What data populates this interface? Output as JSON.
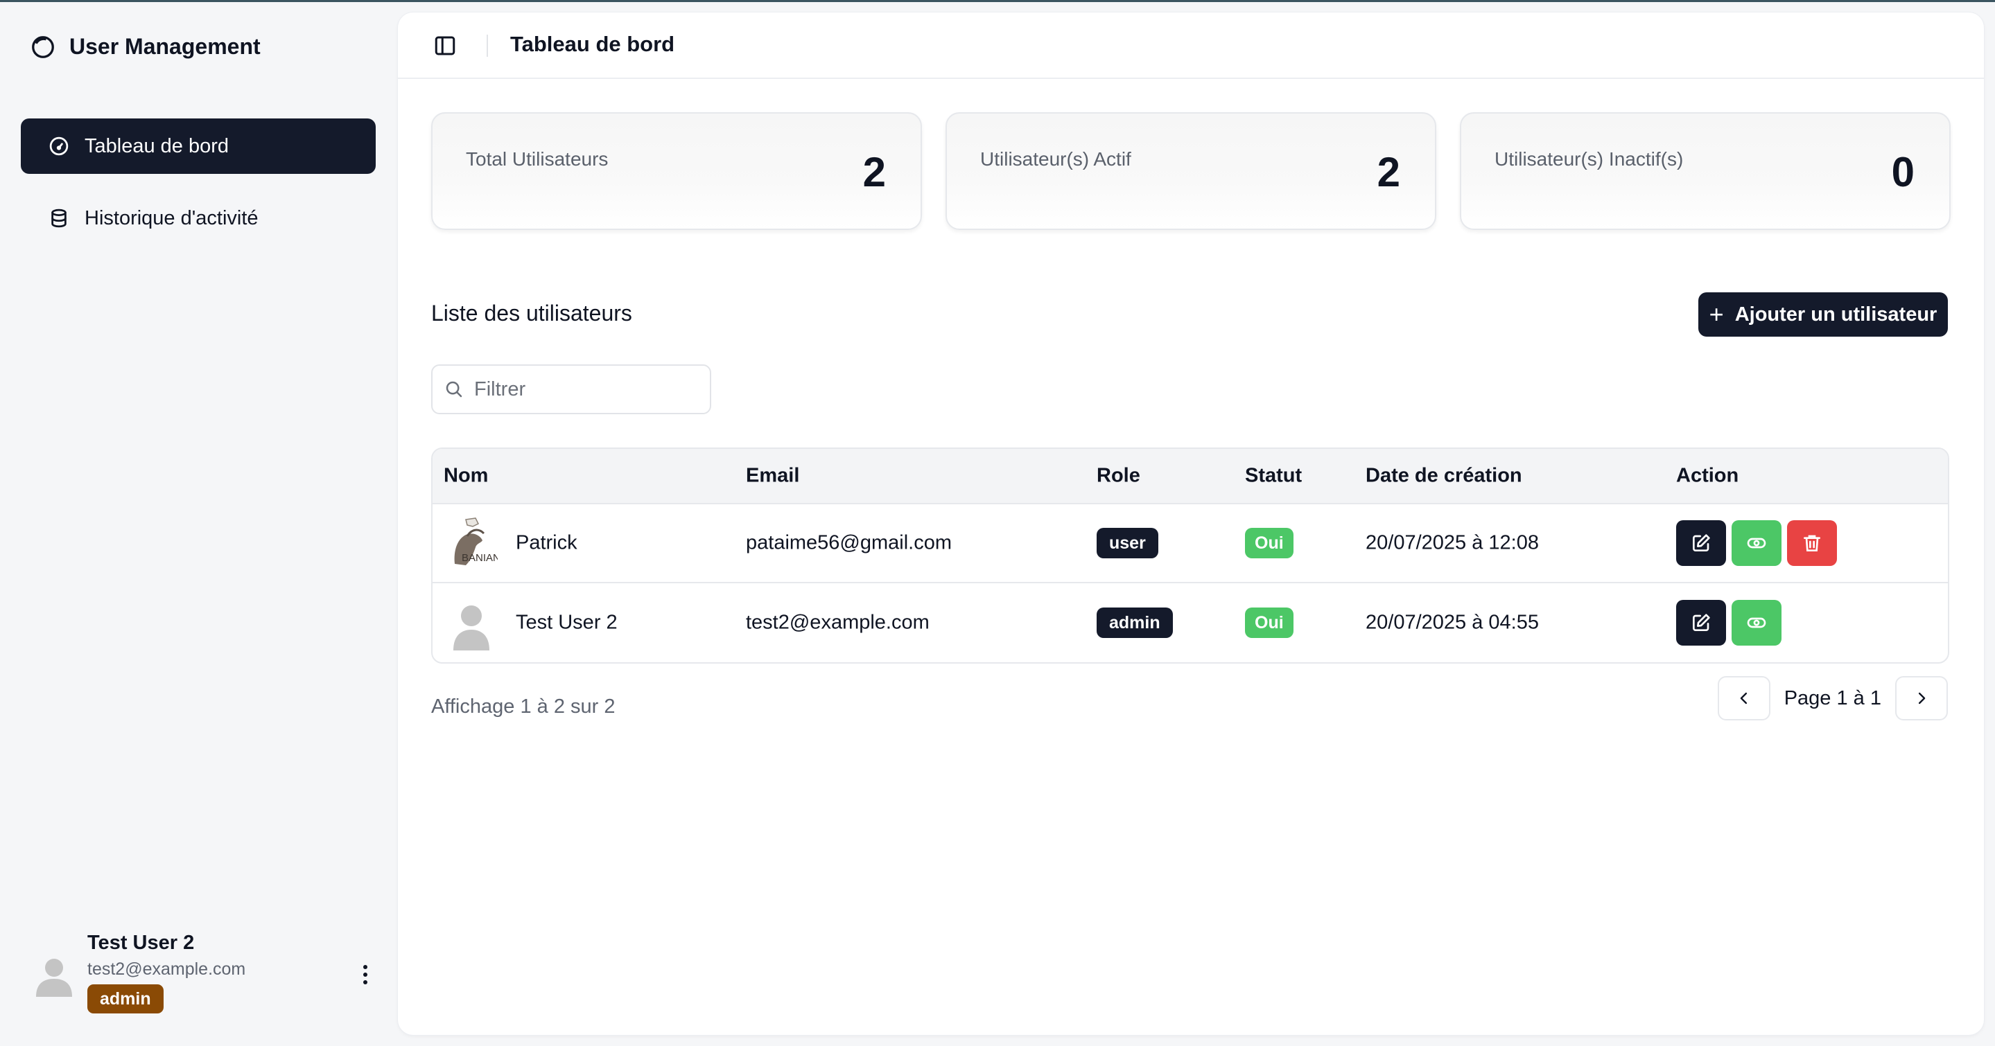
{
  "app": {
    "title": "User Management"
  },
  "sidebar": {
    "items": [
      {
        "label": "Tableau de bord",
        "icon": "gauge-icon",
        "active": true
      },
      {
        "label": "Historique d'activité",
        "icon": "database-icon",
        "active": false
      }
    ],
    "user": {
      "name": "Test User 2",
      "email": "test2@example.com",
      "role": "admin"
    }
  },
  "header": {
    "title": "Tableau de bord"
  },
  "stats": [
    {
      "label": "Total Utilisateurs",
      "value": "2"
    },
    {
      "label": "Utilisateur(s) Actif",
      "value": "2"
    },
    {
      "label": "Utilisateur(s) Inactif(s)",
      "value": "0"
    }
  ],
  "list": {
    "title": "Liste des utilisateurs",
    "add_label": "Ajouter un utilisateur",
    "filter_placeholder": "Filtrer",
    "columns": [
      "Nom",
      "Email",
      "Role",
      "Statut",
      "Date de création",
      "Action"
    ],
    "rows": [
      {
        "name": "Patrick",
        "email": "pataime56@gmail.com",
        "role": "user",
        "status": "Oui",
        "created": "20/07/2025 à 12:08",
        "avatar_text": "BANIAN"
      },
      {
        "name": "Test User 2",
        "email": "test2@example.com",
        "role": "admin",
        "status": "Oui",
        "created": "20/07/2025 à 04:55"
      }
    ],
    "summary": "Affichage 1 à 2 sur 2",
    "page_label": "Page 1 à 1"
  },
  "colors": {
    "primary": "#141a2b",
    "success": "#4cc766",
    "danger": "#e84343",
    "admin_badge": "#8a4a05"
  }
}
